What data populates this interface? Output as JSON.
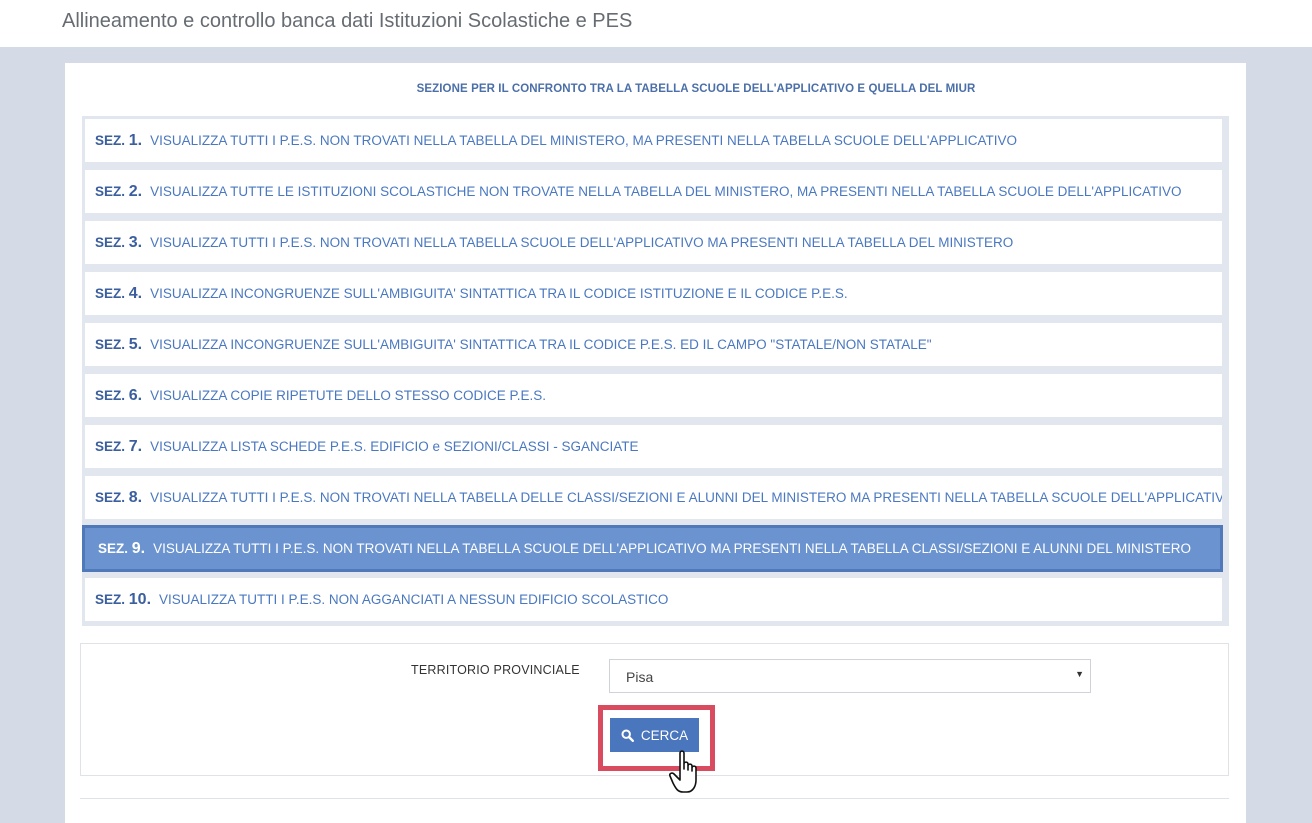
{
  "header": {
    "title": "Allineamento e controllo banca dati Istituzioni Scolastiche e PES"
  },
  "panel": {
    "heading": "SEZIONE PER IL CONFRONTO TRA LA TABELLA SCUOLE DELL'APPLICATIVO E QUELLA DEL MIUR"
  },
  "sections": [
    {
      "prefix": "SEZ.",
      "num": "1.",
      "text": "VISUALIZZA TUTTI I P.E.S. NON TROVATI NELLA TABELLA DEL MINISTERO, MA PRESENTI NELLA TABELLA SCUOLE DELL'APPLICATIVO"
    },
    {
      "prefix": "SEZ.",
      "num": "2.",
      "text": "VISUALIZZA TUTTE LE ISTITUZIONI SCOLASTICHE NON TROVATE NELLA TABELLA DEL MINISTERO, MA PRESENTI NELLA TABELLA SCUOLE DELL'APPLICATIVO"
    },
    {
      "prefix": "SEZ.",
      "num": "3.",
      "text": "VISUALIZZA TUTTI I P.E.S. NON TROVATI NELLA TABELLA SCUOLE DELL'APPLICATIVO MA PRESENTI NELLA TABELLA DEL MINISTERO"
    },
    {
      "prefix": "SEZ.",
      "num": "4.",
      "text": "VISUALIZZA INCONGRUENZE SULL'AMBIGUITA' SINTATTICA TRA IL CODICE ISTITUZIONE E IL CODICE P.E.S."
    },
    {
      "prefix": "SEZ.",
      "num": "5.",
      "text": "VISUALIZZA INCONGRUENZE SULL'AMBIGUITA' SINTATTICA TRA IL CODICE P.E.S. ED IL CAMPO \"STATALE/NON STATALE\""
    },
    {
      "prefix": "SEZ.",
      "num": "6.",
      "text": "VISUALIZZA COPIE RIPETUTE DELLO STESSO CODICE P.E.S."
    },
    {
      "prefix": "SEZ.",
      "num": "7.",
      "text": "VISUALIZZA LISTA SCHEDE P.E.S. EDIFICIO e SEZIONI/CLASSI - SGANCIATE"
    },
    {
      "prefix": "SEZ.",
      "num": "8.",
      "text": "VISUALIZZA TUTTI I P.E.S. NON TROVATI NELLA TABELLA DELLE CLASSI/SEZIONI E ALUNNI DEL MINISTERO MA PRESENTI NELLA TABELLA SCUOLE DELL'APPLICATIVO"
    },
    {
      "prefix": "SEZ.",
      "num": "9.",
      "text": "VISUALIZZA TUTTI I P.E.S. NON TROVATI NELLA TABELLA SCUOLE DELL'APPLICATIVO MA PRESENTI NELLA TABELLA CLASSI/SEZIONI E ALUNNI DEL MINISTERO",
      "active": true
    },
    {
      "prefix": "SEZ.",
      "num": "10.",
      "text": "VISUALIZZA TUTTI I P.E.S. NON AGGANCIATI A NESSUN EDIFICIO SCOLASTICO"
    }
  ],
  "form": {
    "territory_label": "TERRITORIO PROVINCIALE",
    "territory_value": "Pisa",
    "search_label": "CERCA"
  },
  "colors": {
    "accent": "#4a76bd",
    "active_row": "#6a93cf",
    "highlight": "#d94b5e",
    "link_text": "#4a78c0"
  },
  "icons": {
    "search": "search-icon",
    "select_arrow": "dropdown-arrow-icon",
    "cursor": "hand-pointer-cursor-icon"
  }
}
